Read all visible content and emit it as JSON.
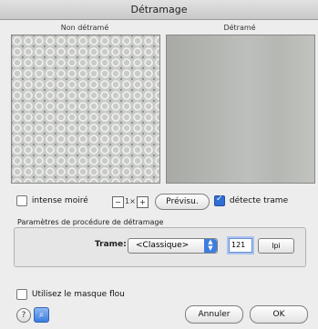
{
  "window": {
    "title": "Détramage"
  },
  "preview": {
    "left_label": "Non détramé",
    "right_label": "Détramé"
  },
  "controls": {
    "intense_moire_label": "intense moiré",
    "intense_moire_checked": false,
    "zoom_label": "1×",
    "preview_button_label": "Prévisu.",
    "detect_screen_label": "détecte trame",
    "detect_screen_checked": true
  },
  "procedure": {
    "group_label": "Paramètres de procédure de détramage",
    "screen_label": "Trame:",
    "screen_value": "<Classique>",
    "lpi_value": "121",
    "unit_button_label": "lpi"
  },
  "unsharp_mask": {
    "label": "Utilisez le masque flou",
    "checked": false
  },
  "footer": {
    "cancel_label": "Annuler",
    "ok_label": "OK"
  },
  "colors": {
    "accent": "#3c7de0",
    "window_bg": "#ededed"
  }
}
